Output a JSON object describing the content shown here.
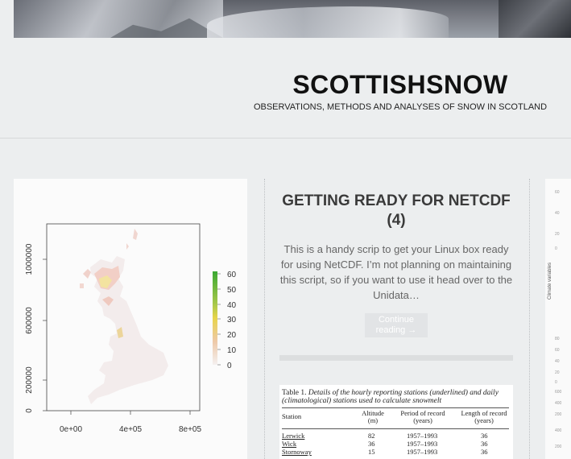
{
  "site": {
    "title": "SCOTTISHSNOW",
    "description": "OBSERVATIONS, METHODS AND ANALYSES OF SNOW IN SCOTLAND"
  },
  "post": {
    "title": "GETTING READY FOR NETCDF (4)",
    "excerpt": "This is a handy scrip to get your Linux box ready for using NetCDF. I’m not planning on maintaining this script, so if you want to use it head over to the Unidata…",
    "continue_label": "Continue reading →"
  },
  "map_plot": {
    "y_ticks": [
      "0",
      "200000",
      "600000",
      "1000000"
    ],
    "x_ticks": [
      "0e+00",
      "4e+05",
      "8e+05"
    ],
    "legend_ticks": [
      "60",
      "50",
      "40",
      "30",
      "20",
      "10",
      "0"
    ],
    "colors": {
      "high": "#3aa832",
      "mid": "#e8d44a",
      "low": "#f1d6cf",
      "zero": "#f4f0f0"
    }
  },
  "table_figure": {
    "caption_label": "Table 1.",
    "caption_text": "Details of the hourly reporting stations (underlined) and daily (climatological) stations used to calculate snowmelt",
    "headers": [
      "Station",
      "Altitude (m)",
      "Period of record (years)",
      "Length of record (years)"
    ],
    "rows": [
      [
        "Lerwick",
        "82",
        "1957–1993",
        "36"
      ],
      [
        "Wick",
        "36",
        "1957–1993",
        "36"
      ],
      [
        "Stornoway",
        "15",
        "1957–1993",
        "36"
      ]
    ]
  },
  "right_chart": {
    "ylabel": "Climate variables",
    "ticks": [
      "60",
      "40",
      "20",
      "0",
      "80",
      "60",
      "40",
      "20",
      "0",
      "600",
      "400",
      "200",
      "400",
      "200"
    ]
  }
}
